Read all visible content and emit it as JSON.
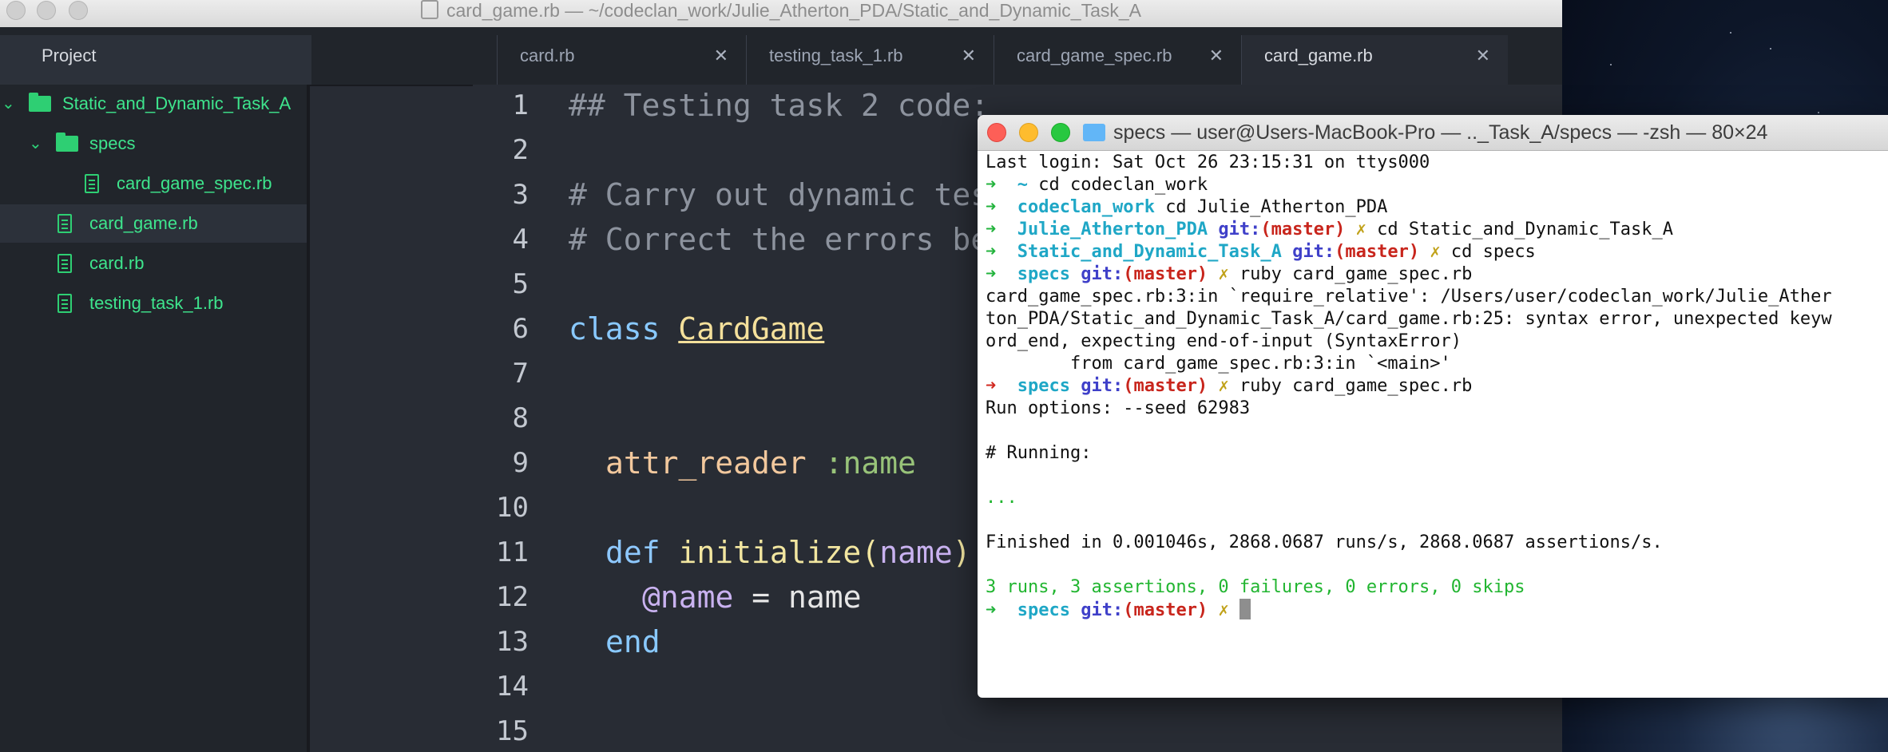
{
  "atom": {
    "window_title": "card_game.rb — ~/codeclan_work/Julie_Atherton_PDA/Static_and_Dynamic_Task_A",
    "project_tab": "Project",
    "tabs": [
      {
        "label": "card.rb",
        "active": false
      },
      {
        "label": "testing_task_1.rb",
        "active": false
      },
      {
        "label": "card_game_spec.rb",
        "active": false
      },
      {
        "label": "card_game.rb",
        "active": true
      }
    ],
    "close_glyph": "✕",
    "tree": [
      {
        "label": "Static_and_Dynamic_Task_A",
        "type": "folder",
        "expanded": true,
        "depth": 0
      },
      {
        "label": "specs",
        "type": "folder",
        "expanded": true,
        "depth": 1
      },
      {
        "label": "card_game_spec.rb",
        "type": "file",
        "depth": 2
      },
      {
        "label": "card_game.rb",
        "type": "file",
        "depth": 1,
        "selected": true
      },
      {
        "label": "card.rb",
        "type": "file",
        "depth": 1
      },
      {
        "label": "testing_task_1.rb",
        "type": "file",
        "depth": 1
      }
    ],
    "line_numbers": [
      "1",
      "2",
      "3",
      "4",
      "5",
      "6",
      "7",
      "8",
      "9",
      "10",
      "11",
      "12",
      "13",
      "14",
      "15"
    ],
    "code": {
      "l1": "## Testing task 2 code:",
      "l3": "# Carry out dynamic tes",
      "l4": "# Correct the errors be",
      "l6_kw": "class",
      "l6_name": "CardGame",
      "l9_attr": "attr_reader",
      "l9_sym": ":name",
      "l11_def": "def",
      "l11_fn": "initialize",
      "l11_paren_open": "(",
      "l11_arg": "name",
      "l11_paren_close": ")",
      "l12_ivar": "@name",
      "l12_rest": " = name",
      "l13_end": "end"
    }
  },
  "terminal": {
    "title": "specs — user@Users-MacBook-Pro — .._Task_A/specs — -zsh — 80×24",
    "last_login": "Last login: Sat Oct 26 23:15:31 on ttys000",
    "arrow": "➜",
    "git_label": "git:",
    "branch": "(master)",
    "dirty": "✗",
    "lines": {
      "p1_dir": "~",
      "p1_cmd": "cd codeclan_work",
      "p2_dir": "codeclan_work",
      "p2_cmd": "cd Julie_Atherton_PDA",
      "p3_dir": "Julie_Atherton_PDA",
      "p3_cmd": "cd Static_and_Dynamic_Task_A",
      "p4_dir": "Static_and_Dynamic_Task_A",
      "p4_cmd": "cd specs",
      "p5_dir": "specs",
      "p5_cmd": "ruby card_game_spec.rb",
      "err1": "card_game_spec.rb:3:in `require_relative': /Users/user/codeclan_work/Julie_Ather",
      "err2": "ton_PDA/Static_and_Dynamic_Task_A/card_game.rb:25: syntax error, unexpected keyw",
      "err3": "ord_end, expecting end-of-input (SyntaxError)",
      "err4": "        from card_game_spec.rb:3:in `<main>'",
      "p6_dir": "specs",
      "p6_cmd": "ruby card_game_spec.rb",
      "run_opts": "Run options: --seed 62983",
      "running": "# Running:",
      "dots": "...",
      "finished": "Finished in 0.001046s, 2868.0687 runs/s, 2868.0687 assertions/s.",
      "summary": "3 runs, 3 assertions, 0 failures, 0 errors, 0 skips",
      "p7_dir": "specs"
    }
  }
}
